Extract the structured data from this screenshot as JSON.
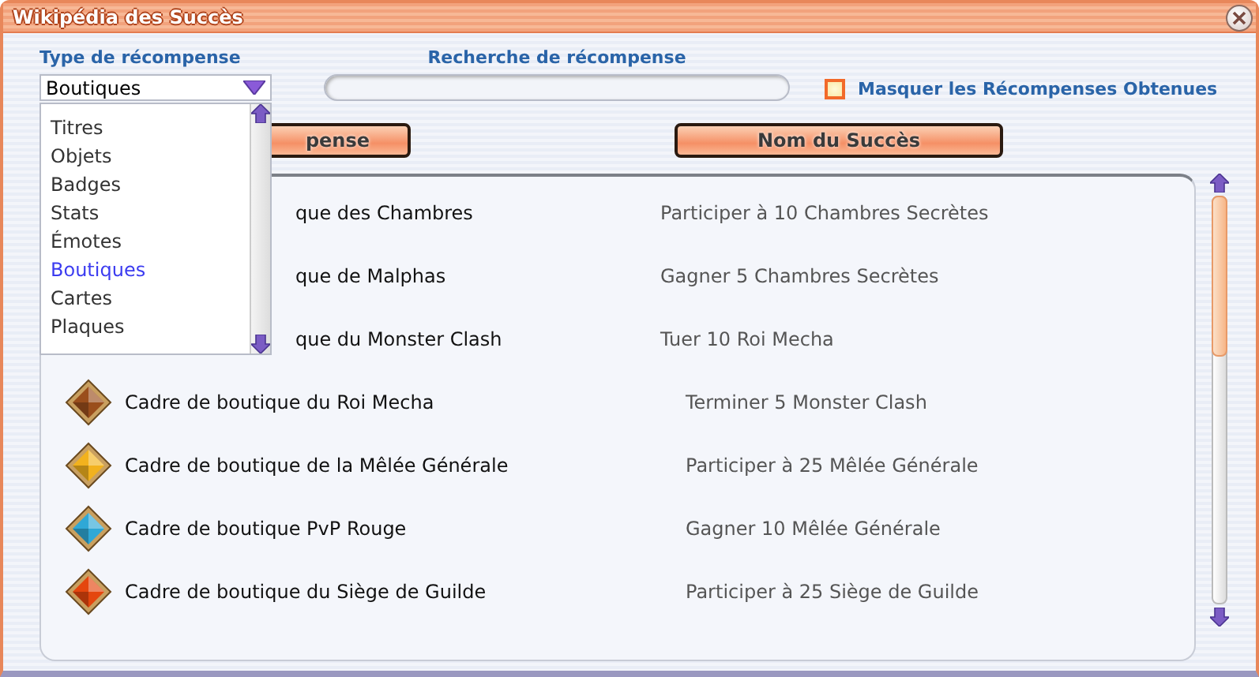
{
  "window": {
    "title": "Wikipédia des Succès"
  },
  "filters": {
    "type_label": "Type de récompense",
    "type_value": "Boutiques",
    "search_label": "Recherche de récompense",
    "hide_label": "Masquer les Récompenses Obtenues",
    "hide_checked": false
  },
  "type_options": [
    {
      "label": "Titres",
      "selected": false
    },
    {
      "label": "Objets",
      "selected": false
    },
    {
      "label": "Badges",
      "selected": false
    },
    {
      "label": "Stats",
      "selected": false
    },
    {
      "label": "Émotes",
      "selected": false
    },
    {
      "label": "Boutiques",
      "selected": true
    },
    {
      "label": "Cartes",
      "selected": false
    },
    {
      "label": "Plaques",
      "selected": false
    }
  ],
  "columns": [
    "pense",
    "Nom du Succès"
  ],
  "rows": [
    {
      "name": "que des Chambres",
      "requirement": "Participer à 10 Chambres Secrètes",
      "covered": true
    },
    {
      "name": "que de Malphas",
      "requirement": "Gagner 5 Chambres Secrètes",
      "covered": true
    },
    {
      "name": "que du Monster Clash",
      "requirement": "Tuer 10 Roi Mecha",
      "covered": true
    },
    {
      "name": "Cadre de boutique du Roi Mecha",
      "requirement": "Terminer 5 Monster Clash",
      "covered": false,
      "color": "#9a4e1c"
    },
    {
      "name": "Cadre de boutique de la Mêlée Générale",
      "requirement": "Participer à 25 Mêlée Générale",
      "covered": false,
      "color": "#f2b21e"
    },
    {
      "name": "Cadre de boutique PvP Rouge",
      "requirement": "Gagner 10 Mêlée Générale",
      "covered": false,
      "color": "#2fa8d6"
    },
    {
      "name": "Cadre de boutique du Siège de Guilde",
      "requirement": "Participer à 25 Siège de Guilde",
      "covered": false,
      "color": "#e4460e"
    }
  ]
}
